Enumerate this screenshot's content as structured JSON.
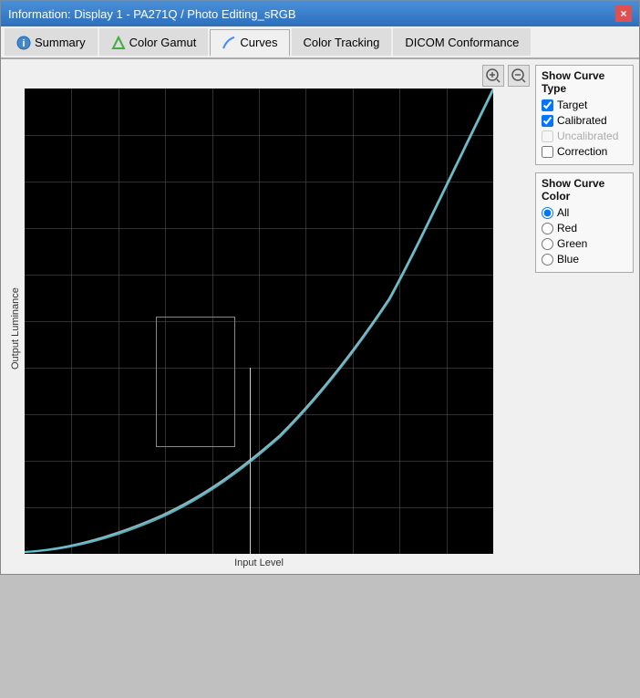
{
  "window": {
    "title": "Information: Display 1 - PA271Q / Photo Editing_sRGB",
    "close_label": "×"
  },
  "tabs": [
    {
      "id": "summary",
      "label": "Summary",
      "icon": "info",
      "active": false
    },
    {
      "id": "color-gamut",
      "label": "Color Gamut",
      "icon": "triangle",
      "active": false
    },
    {
      "id": "curves",
      "label": "Curves",
      "icon": "curves",
      "active": true
    },
    {
      "id": "color-tracking",
      "label": "Color Tracking",
      "active": false
    },
    {
      "id": "dicom",
      "label": "DICOM Conformance",
      "active": false
    }
  ],
  "chart": {
    "zoom_in_title": "+",
    "zoom_out_title": "-",
    "y_axis_label": "Output Luminance",
    "x_axis_label": "Input Level"
  },
  "sidebar": {
    "curve_type_group_title": "Show Curve Type",
    "checkboxes": [
      {
        "id": "target",
        "label": "Target",
        "checked": true,
        "disabled": false
      },
      {
        "id": "calibrated",
        "label": "Calibrated",
        "checked": true,
        "disabled": false
      },
      {
        "id": "uncalibrated",
        "label": "Uncalibrated",
        "checked": false,
        "disabled": true
      },
      {
        "id": "correction",
        "label": "Correction",
        "checked": false,
        "disabled": false
      }
    ],
    "curve_color_group_title": "Show Curve Color",
    "radios": [
      {
        "id": "all",
        "label": "All",
        "checked": true
      },
      {
        "id": "red",
        "label": "Red",
        "checked": false
      },
      {
        "id": "green",
        "label": "Green",
        "checked": false
      },
      {
        "id": "blue",
        "label": "Blue",
        "checked": false
      }
    ]
  }
}
